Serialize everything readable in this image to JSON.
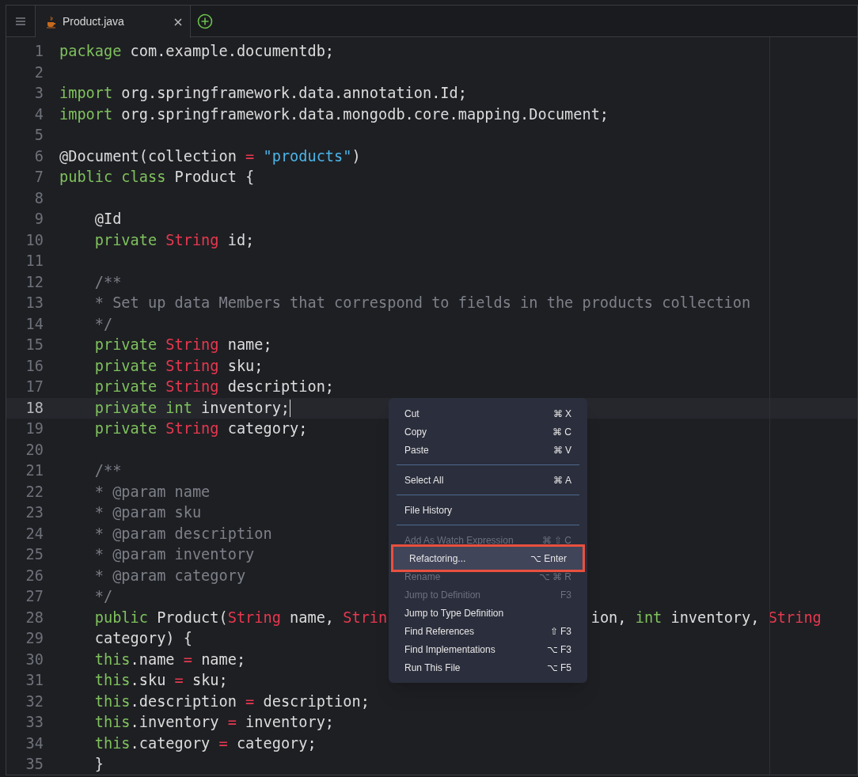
{
  "tabs": [
    {
      "label": "Product.java",
      "selected": true
    }
  ],
  "editor": {
    "lines": [
      {
        "number": "1",
        "current": false,
        "tokens": [
          {
            "kind": "keyword",
            "text": "package"
          },
          {
            "kind": "plain",
            "text": " com.example.documentdb;"
          }
        ]
      },
      {
        "number": "2",
        "current": false
      },
      {
        "number": "3",
        "current": false,
        "tokens": [
          {
            "kind": "keyword",
            "text": "import"
          },
          {
            "kind": "plain",
            "text": " org.springframework.data.annotation.Id;"
          }
        ]
      },
      {
        "number": "4",
        "current": false,
        "tokens": [
          {
            "kind": "keyword",
            "text": "import"
          },
          {
            "kind": "plain",
            "text": " org.springframework.data.mongodb.core.mapping.Document;"
          }
        ]
      },
      {
        "number": "5",
        "current": false
      },
      {
        "number": "6",
        "current": false,
        "tokens": [
          {
            "kind": "plain",
            "text": "@Document(collection "
          },
          {
            "kind": "operator",
            "text": "="
          },
          {
            "kind": "string",
            "text": " \"products\""
          },
          {
            "kind": "plain",
            "text": ")"
          }
        ]
      },
      {
        "number": "7",
        "current": false,
        "tokens": [
          {
            "kind": "keyword",
            "text": "public class"
          },
          {
            "kind": "plain",
            "text": " Product {"
          }
        ]
      },
      {
        "number": "8",
        "current": false
      },
      {
        "number": "9",
        "current": false,
        "tokens": [
          {
            "kind": "plain",
            "text": "    @Id"
          }
        ]
      },
      {
        "number": "10",
        "current": false,
        "tokens": [
          {
            "kind": "keyword",
            "text": "    private"
          },
          {
            "kind": "type",
            "text": " String"
          },
          {
            "kind": "plain",
            "text": " id;"
          }
        ]
      },
      {
        "number": "11",
        "current": false
      },
      {
        "number": "12",
        "current": false,
        "tokens": [
          {
            "kind": "comment",
            "text": "    /**"
          }
        ]
      },
      {
        "number": "13",
        "current": false,
        "tokens": [
          {
            "kind": "comment",
            "text": "    * Set up data Members that correspond to fields in the products collection"
          }
        ]
      },
      {
        "number": "14",
        "current": false,
        "tokens": [
          {
            "kind": "comment",
            "text": "    */"
          }
        ]
      },
      {
        "number": "15",
        "current": false,
        "tokens": [
          {
            "kind": "keyword",
            "text": "    private"
          },
          {
            "kind": "type",
            "text": " String"
          },
          {
            "kind": "plain",
            "text": " name;"
          }
        ]
      },
      {
        "number": "16",
        "current": false,
        "tokens": [
          {
            "kind": "keyword",
            "text": "    private"
          },
          {
            "kind": "type",
            "text": " String"
          },
          {
            "kind": "plain",
            "text": " sku;"
          }
        ]
      },
      {
        "number": "17",
        "current": false,
        "tokens": [
          {
            "kind": "keyword",
            "text": "    private"
          },
          {
            "kind": "type",
            "text": " String"
          },
          {
            "kind": "plain",
            "text": " description;"
          }
        ]
      },
      {
        "number": "18",
        "current": true,
        "tokens": [
          {
            "kind": "keyword",
            "text": "    private int"
          },
          {
            "kind": "plain",
            "text": " inventory;"
          }
        ]
      },
      {
        "number": "19",
        "current": false,
        "tokens": [
          {
            "kind": "keyword",
            "text": "    private"
          },
          {
            "kind": "type",
            "text": " String"
          },
          {
            "kind": "plain",
            "text": " category;"
          }
        ]
      },
      {
        "number": "20",
        "current": false
      },
      {
        "number": "21",
        "current": false,
        "tokens": [
          {
            "kind": "comment",
            "text": "    /**"
          }
        ]
      },
      {
        "number": "22",
        "current": false,
        "tokens": [
          {
            "kind": "comment",
            "text": "    * @param name"
          }
        ]
      },
      {
        "number": "23",
        "current": false,
        "tokens": [
          {
            "kind": "comment",
            "text": "    * @param sku"
          }
        ]
      },
      {
        "number": "24",
        "current": false,
        "tokens": [
          {
            "kind": "comment",
            "text": "    * @param description"
          }
        ]
      },
      {
        "number": "25",
        "current": false,
        "tokens": [
          {
            "kind": "comment",
            "text": "    * @param inventory"
          }
        ]
      },
      {
        "number": "26",
        "current": false,
        "tokens": [
          {
            "kind": "comment",
            "text": "    * @param category"
          }
        ]
      },
      {
        "number": "27",
        "current": false,
        "tokens": [
          {
            "kind": "comment",
            "text": "    */"
          }
        ]
      },
      {
        "number": "28",
        "current": false,
        "tokens": [
          {
            "kind": "keyword",
            "text": "    public"
          },
          {
            "kind": "plain",
            "text": " Product("
          },
          {
            "kind": "type",
            "text": "String"
          },
          {
            "kind": "plain",
            "text": " name, "
          },
          {
            "kind": "type",
            "text": "Strin"
          },
          {
            "kind": "gap"
          },
          {
            "kind": "plain",
            "text": "ion, "
          },
          {
            "kind": "keyword",
            "text": "int"
          },
          {
            "kind": "plain",
            "text": " inventory, "
          },
          {
            "kind": "type",
            "text": "String"
          }
        ]
      },
      {
        "number": "29",
        "current": false,
        "tokens": [
          {
            "kind": "plain",
            "text": "    category) {"
          }
        ]
      },
      {
        "number": "30",
        "current": false,
        "tokens": [
          {
            "kind": "keyword",
            "text": "    this"
          },
          {
            "kind": "plain",
            "text": ".name "
          },
          {
            "kind": "operator",
            "text": "="
          },
          {
            "kind": "plain",
            "text": " name;"
          }
        ]
      },
      {
        "number": "31",
        "current": false,
        "tokens": [
          {
            "kind": "keyword",
            "text": "    this"
          },
          {
            "kind": "plain",
            "text": ".sku "
          },
          {
            "kind": "operator",
            "text": "="
          },
          {
            "kind": "plain",
            "text": " sku;"
          }
        ]
      },
      {
        "number": "32",
        "current": false,
        "tokens": [
          {
            "kind": "keyword",
            "text": "    this"
          },
          {
            "kind": "plain",
            "text": ".description "
          },
          {
            "kind": "operator",
            "text": "="
          },
          {
            "kind": "plain",
            "text": " description;"
          }
        ]
      },
      {
        "number": "33",
        "current": false,
        "tokens": [
          {
            "kind": "keyword",
            "text": "    this"
          },
          {
            "kind": "plain",
            "text": ".inventory "
          },
          {
            "kind": "operator",
            "text": "="
          },
          {
            "kind": "plain",
            "text": " inventory;"
          }
        ]
      },
      {
        "number": "34",
        "current": false,
        "tokens": [
          {
            "kind": "keyword",
            "text": "    this"
          },
          {
            "kind": "plain",
            "text": ".category "
          },
          {
            "kind": "operator",
            "text": "="
          },
          {
            "kind": "plain",
            "text": " category;"
          }
        ]
      },
      {
        "number": "35",
        "current": false,
        "tokens": [
          {
            "kind": "plain",
            "text": "    }"
          }
        ]
      }
    ]
  },
  "context_menu": {
    "groups": [
      [
        {
          "label": "Cut",
          "shortcut": "⌘ X",
          "disabled": false,
          "selected": false,
          "outlined": false
        },
        {
          "label": "Copy",
          "shortcut": "⌘ C",
          "disabled": false,
          "selected": false,
          "outlined": false
        },
        {
          "label": "Paste",
          "shortcut": "⌘ V",
          "disabled": false,
          "selected": false,
          "outlined": false
        }
      ],
      [
        {
          "label": "Select All",
          "shortcut": "⌘ A",
          "disabled": false,
          "selected": false,
          "outlined": false
        }
      ],
      [
        {
          "label": "File History",
          "disabled": false,
          "selected": false,
          "outlined": false
        }
      ],
      [
        {
          "label": "Add As Watch Expression",
          "shortcut": "⌘ ⇧ C",
          "disabled": true,
          "selected": false,
          "outlined": false
        },
        {
          "label": "Refactoring...",
          "shortcut": "⌥ Enter",
          "disabled": false,
          "selected": true,
          "outlined": true
        },
        {
          "label": "Rename",
          "shortcut": "⌥ ⌘ R",
          "disabled": true,
          "selected": false,
          "outlined": false
        },
        {
          "label": "Jump to Definition",
          "shortcut": "F3",
          "disabled": true,
          "selected": false,
          "outlined": false
        },
        {
          "label": "Jump to Type Definition",
          "disabled": false,
          "selected": false,
          "outlined": false
        },
        {
          "label": "Find References",
          "shortcut": "⇧ F3",
          "disabled": false,
          "selected": false,
          "outlined": false
        },
        {
          "label": "Find Implementations",
          "shortcut": "⌥ F3",
          "disabled": false,
          "selected": false,
          "outlined": false
        },
        {
          "label": "Run This File",
          "shortcut": "⌥ F5",
          "disabled": false,
          "selected": false,
          "outlined": false
        }
      ]
    ]
  }
}
